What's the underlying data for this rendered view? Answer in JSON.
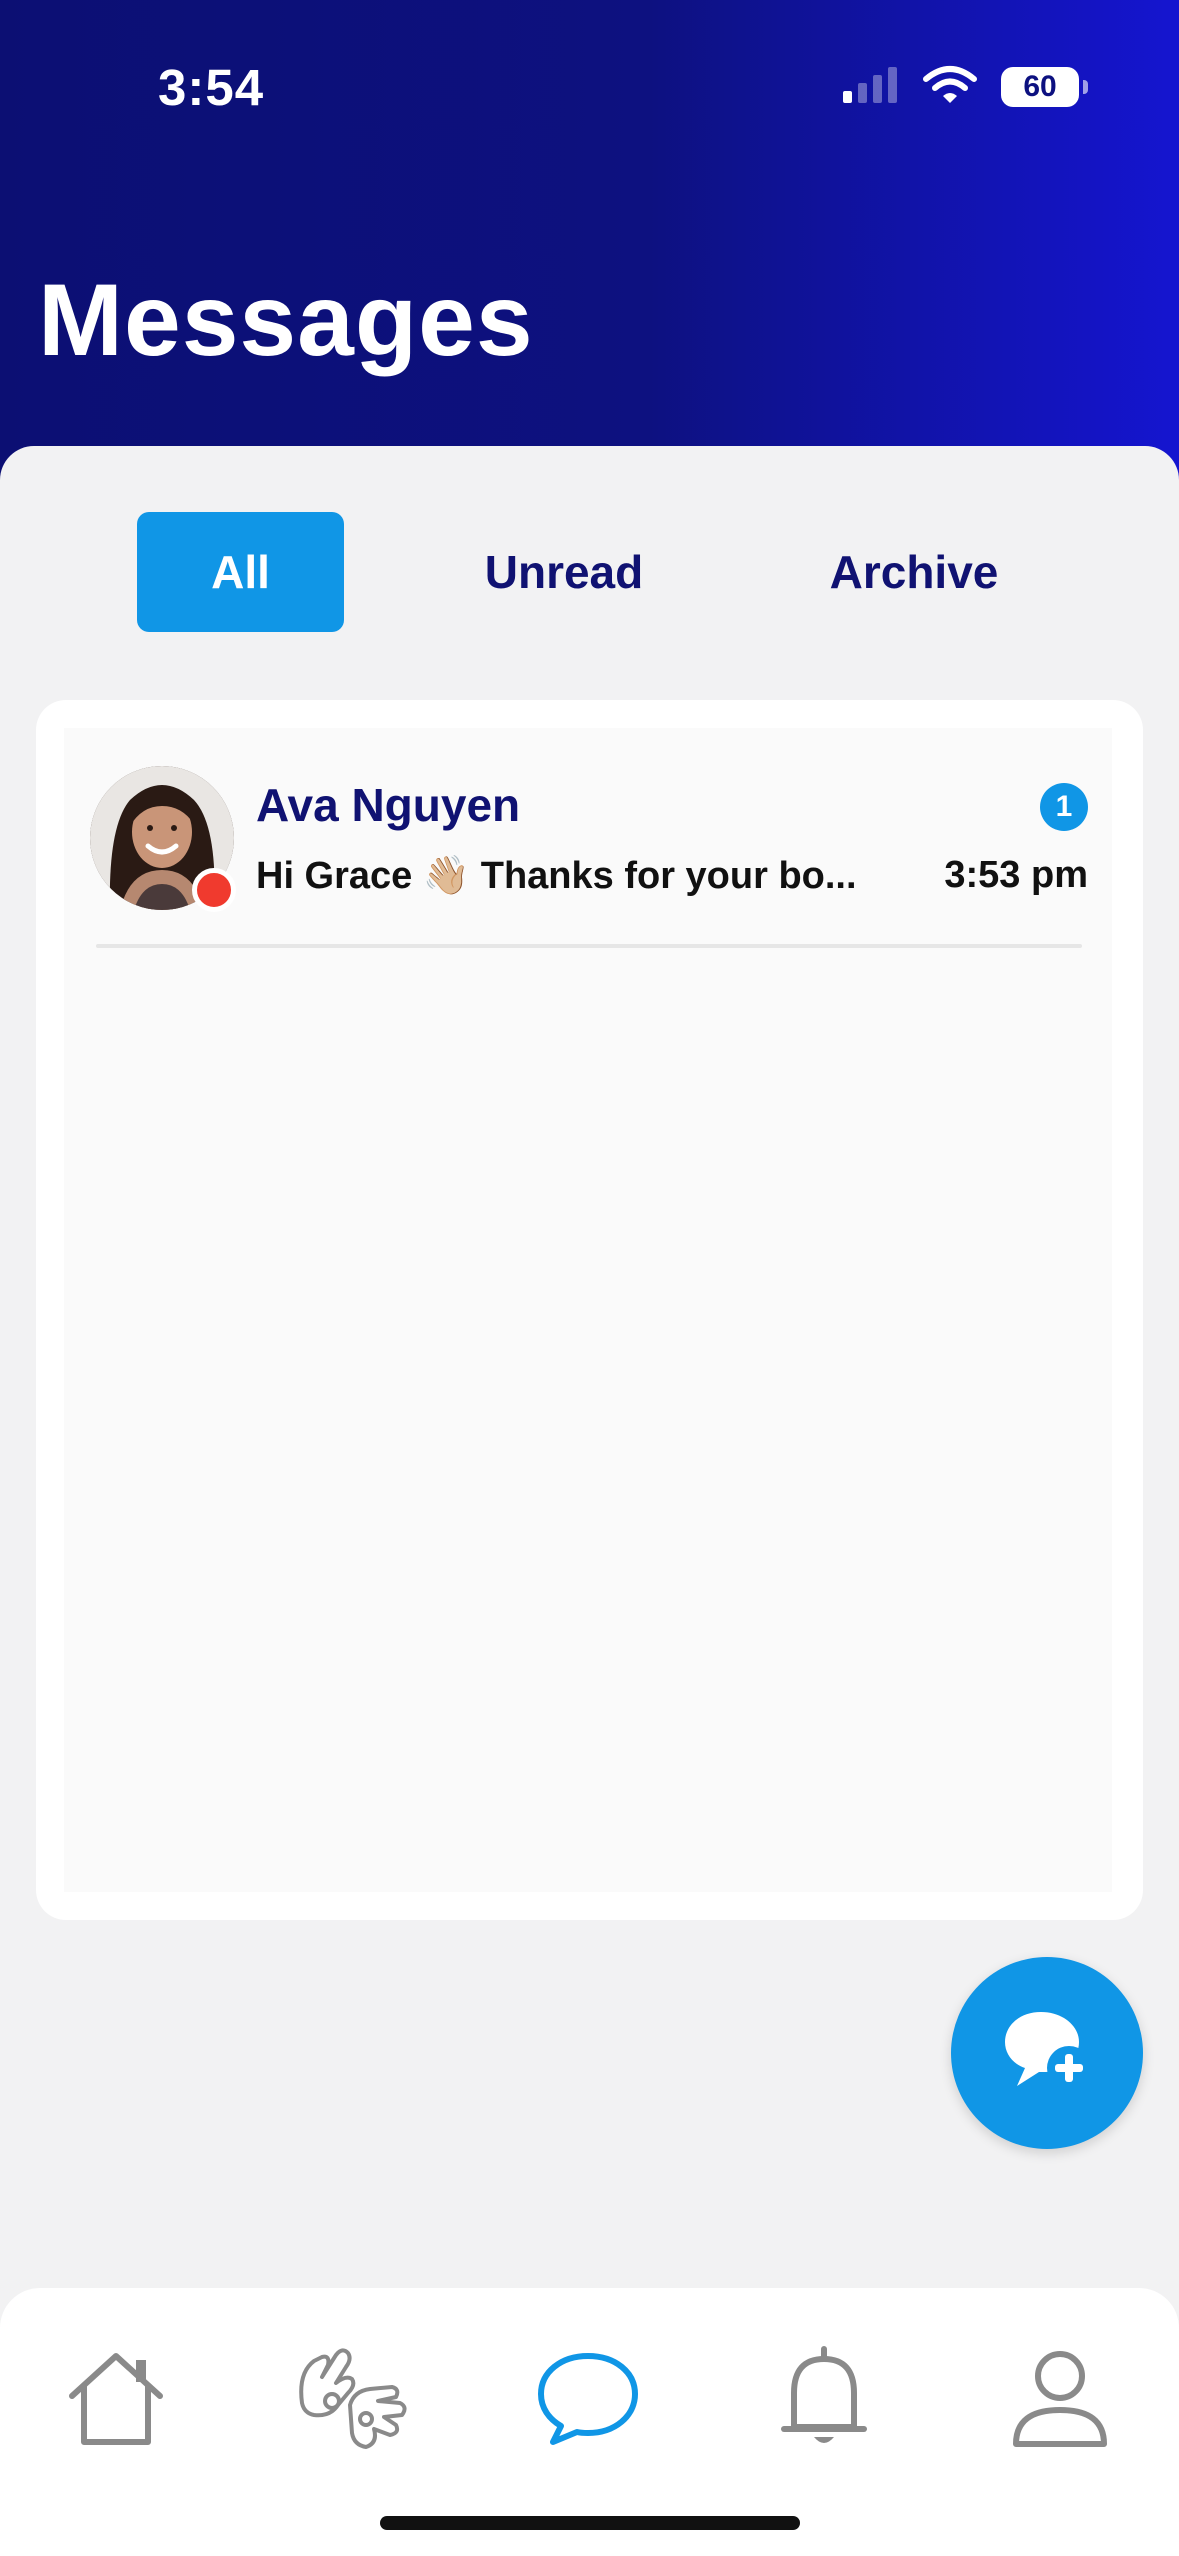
{
  "status_bar": {
    "time": "3:54",
    "battery": "60",
    "signal_icon": "cellular-signal-icon",
    "wifi_icon": "wifi-icon"
  },
  "header": {
    "title": "Messages"
  },
  "tabs": [
    {
      "label": "All",
      "active": true
    },
    {
      "label": "Unread",
      "active": false
    },
    {
      "label": "Archive",
      "active": false
    }
  ],
  "conversations": [
    {
      "name": "Ava Nguyen",
      "preview": "Hi Grace 👋🏼 Thanks for your bo...",
      "time": "3:53 pm",
      "unread_count": "1",
      "online": true
    }
  ],
  "fab": {
    "icon": "new-message-icon"
  },
  "bottom_nav": {
    "items": [
      {
        "icon": "home-icon",
        "active": false
      },
      {
        "icon": "sign-language-icon",
        "active": false
      },
      {
        "icon": "chat-bubble-icon",
        "active": true
      },
      {
        "icon": "bell-icon",
        "active": false
      },
      {
        "icon": "profile-icon",
        "active": false
      }
    ]
  },
  "colors": {
    "header_start": "#0c0f73",
    "header_end": "#1515d0",
    "accent": "#1096e6",
    "navy_text": "#101272",
    "online_dot": "#f03a2e",
    "nav_inactive": "#8a8a8a"
  }
}
